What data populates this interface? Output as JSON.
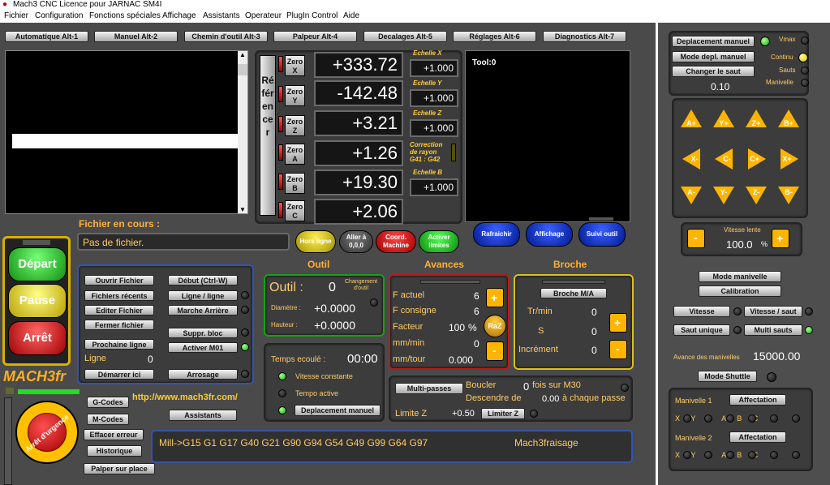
{
  "title": "Mach3 CNC  Licence pour JARNAC SM4I",
  "menu": [
    "Fichier",
    "Configuration",
    "Fonctions spéciales",
    "Affichage",
    "Assistants",
    "Operateur",
    "PlugIn Control",
    "Aide"
  ],
  "tabs": [
    "Automatique Alt-1",
    "Manuel Alt-2",
    "Chemin d'outil Alt-3",
    "Palpeur Alt-4",
    "Decalages Alt-5",
    "Réglages Alt-6",
    "Diagnostics Alt-7"
  ],
  "ref_label": "Référencer",
  "axes": [
    {
      "zero": "Zero X",
      "value": "+333.72"
    },
    {
      "zero": "Zero Y",
      "value": "-142.48"
    },
    {
      "zero": "Zero Z",
      "value": "+3.21"
    },
    {
      "zero": "Zero A",
      "value": "+1.26"
    },
    {
      "zero": "Zero B",
      "value": "+19.30"
    },
    {
      "zero": "Zero C",
      "value": "+2.06"
    }
  ],
  "scales": [
    {
      "label": "Echelle X",
      "value": "+1.000"
    },
    {
      "label": "Echelle Y",
      "value": "+1.000"
    },
    {
      "label": "Echelle Z",
      "value": "+1.000"
    },
    {
      "label": "Correction de rayon G41 : G42",
      "value": ""
    },
    {
      "label": "Echelle B",
      "value": "+1.000"
    }
  ],
  "tool_label": "Tool:0",
  "blue_buttons": [
    "Rafraichir",
    "Affichage",
    "Suivi outil"
  ],
  "file": {
    "label": "Fichier en cours :",
    "value": "Pas de fichier."
  },
  "mode_buttons": [
    "Hors ligne",
    "Aller à 0,0,0",
    "Coord. Machine",
    "Activer limites"
  ],
  "main_buttons": {
    "depart": "Départ",
    "pause": "Pause",
    "arret": "Arrêt"
  },
  "logo": "MACH3fr",
  "file_buttons": [
    "Ouvrir Fichier",
    "Fichiers récents",
    "Editer Fichier",
    "Fermer fichier",
    "Prochaine ligne"
  ],
  "line": {
    "label": "Ligne",
    "value": "0"
  },
  "demarrer": "Démarrer ici",
  "right_buttons": [
    "Début (Ctrl-W)",
    "Ligne / ligne",
    "Marche Arrière",
    "Suppr. bloc",
    "Activer M01",
    "Arrosage"
  ],
  "outil": {
    "title": "Outil",
    "label": "Outil :",
    "value": "0",
    "change": "Changement d'outil",
    "diam_label": "Diamètre :",
    "diam": "+0.0000",
    "haut_label": "Hauteur :",
    "haut": "+0.0000"
  },
  "avances": {
    "title": "Avances",
    "actuel_label": "F actuel",
    "actuel": "6",
    "consigne_label": "F consigne",
    "consigne": "6",
    "facteur_label": "Facteur",
    "facteur": "100",
    "pct": "%",
    "raz": "RaZ",
    "mmmin_label": "mm/min",
    "mmmin": "0",
    "mmtour_label": "mm/tour",
    "mmtour": "0.000"
  },
  "broche": {
    "title": "Broche",
    "ma": "Broche M/A",
    "trmin_label": "Tr/min",
    "trmin": "0",
    "s_label": "S",
    "s": "0",
    "inc_label": "Incrément",
    "inc": "0"
  },
  "temps": {
    "label": "Temps ecoulé :",
    "value": "00:00",
    "vitesse": "Vitesse constante",
    "tempo": "Tempo active",
    "depl": "Deplacement manuel"
  },
  "multi": {
    "btn": "Multi-passes",
    "boucler": "Boucler",
    "boucler_val": "0",
    "fois": "fois sur M30",
    "descendre": "Descendre de",
    "descendre_val": "0.00",
    "chaque": "à chaque passe",
    "limite_label": "Limite Z",
    "limite_val": "+0.50",
    "limiter": "Limiter Z"
  },
  "bottom_left": [
    "G-Codes",
    "M-Codes",
    "Effacer erreur",
    "Historique",
    "Palper sur place"
  ],
  "url": "http://www.mach3fr.com/",
  "assistants": "Assistants",
  "estop": "Arrêt d'urgence",
  "status": {
    "text": "Mill->G15  G1 G17 G40 G21 G90 G94 G54 G49 G99 G64 G97",
    "profile": "Mach3fraisage"
  },
  "side": {
    "depl_btn": "Deplacement manuel",
    "mode_btn": "Mode depl. manuel",
    "changer_btn": "Changer le saut",
    "saut_val": "0.10",
    "vmax": "Vmax",
    "continu": "Continu",
    "sauts": "Sauts",
    "manivelle": "Manivelle",
    "jog": [
      "A+",
      "Y+",
      "Z+",
      "B+",
      "X-",
      "C-",
      "C+",
      "X+",
      "A-",
      "Y-",
      "Z-",
      "B-"
    ],
    "vitesse_lente": "Vitesse lente",
    "vitesse_val": "100.0",
    "pct": "%",
    "mode_manivelle": "Mode manivelle",
    "calibration": "Calibration",
    "vitesse": "Vitesse",
    "vitesse_saut": "Vitesse / saut",
    "saut_unique": "Saut unique",
    "multi_sauts": "Multi sauts",
    "avance_label": "Avance des manivelles",
    "avance_val": "15000.00",
    "shuttle": "Mode Shuttle",
    "man1": "Manivelle 1",
    "man2": "Manivelle 2",
    "affectation": "Affectation",
    "axes_letters": [
      "X",
      "Y",
      "Z",
      "A",
      "B",
      "C"
    ]
  }
}
